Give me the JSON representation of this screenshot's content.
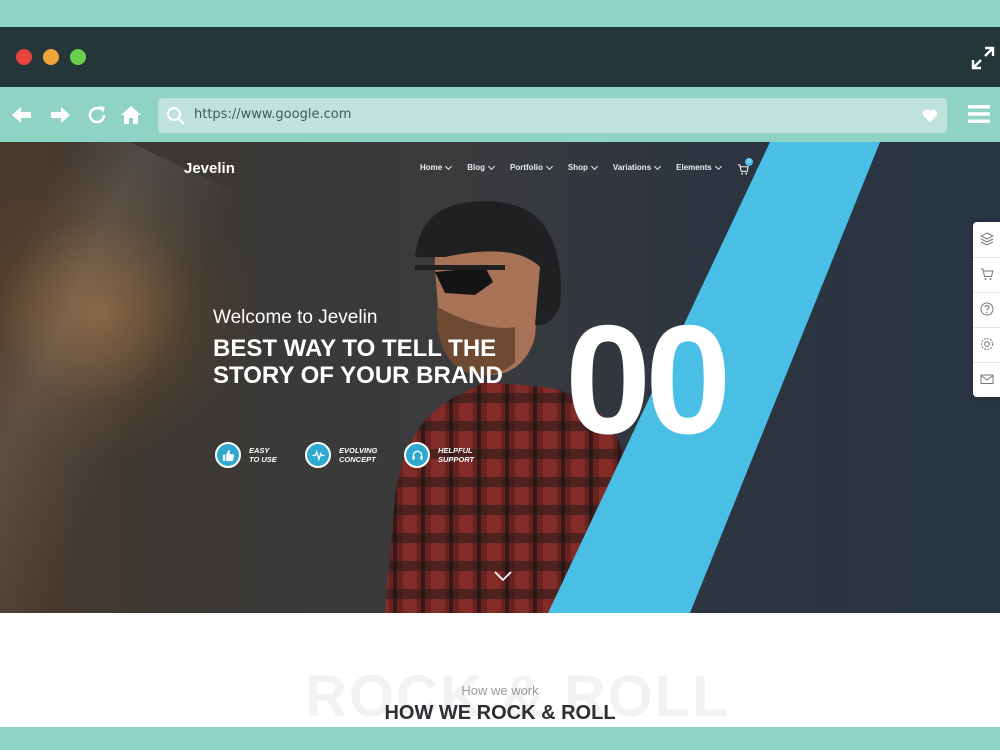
{
  "browser": {
    "url": "https://www.google.com"
  },
  "site": {
    "brand": "Jevelin",
    "nav": [
      {
        "label": "Home"
      },
      {
        "label": "Blog"
      },
      {
        "label": "Portfolio"
      },
      {
        "label": "Shop"
      },
      {
        "label": "Variations"
      },
      {
        "label": "Elements"
      }
    ],
    "cart_count": "0"
  },
  "hero": {
    "welcome": "Welcome to Jevelin",
    "headline_line1": "BEST WAY TO TELL THE",
    "headline_line2": "STORY OF YOUR BRAND",
    "big_number": "00",
    "features": [
      {
        "line1": "EASY",
        "line2": "TO USE",
        "icon": "thumbs-up-icon"
      },
      {
        "line1": "EVOLVING",
        "line2": "CONCEPT",
        "icon": "pulse-icon"
      },
      {
        "line1": "HELPFUL",
        "line2": "SUPPORT",
        "icon": "headset-icon"
      }
    ]
  },
  "section": {
    "watermark": "ROCK & ROLL",
    "subtitle": "How we work",
    "title": "HOW WE ROCK & ROLL"
  },
  "colors": {
    "accent": "#49bfe6",
    "frame": "#8fd3c4",
    "titlebar": "#243638"
  }
}
